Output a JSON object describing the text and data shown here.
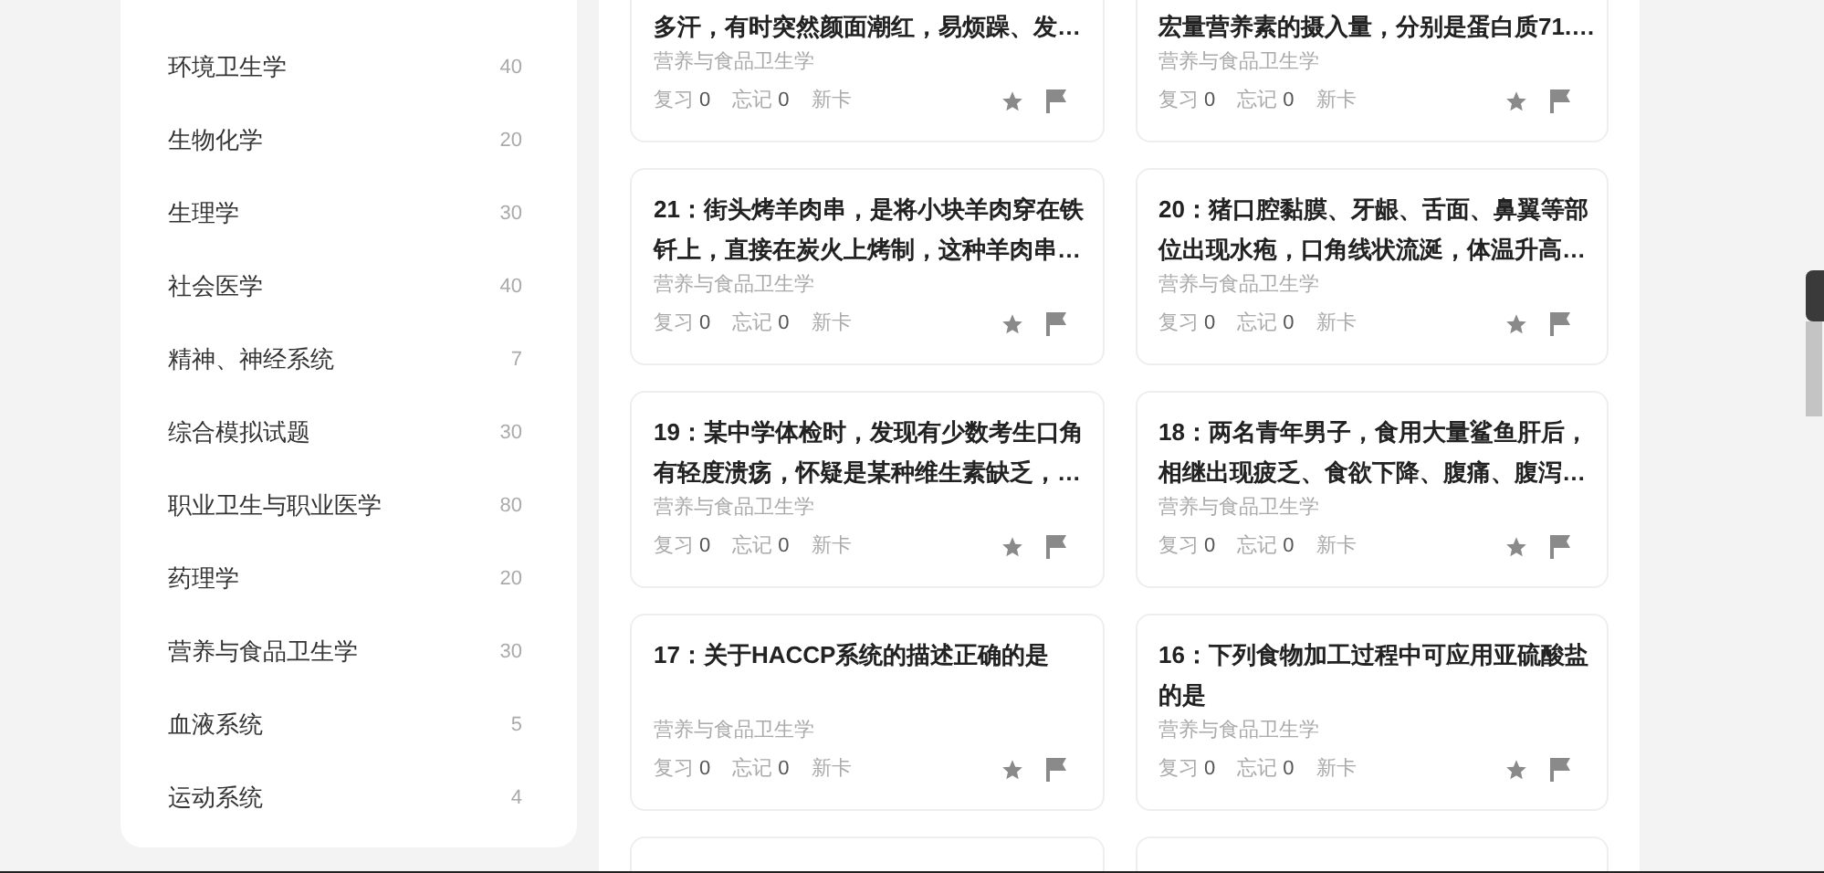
{
  "sidebar": {
    "items": [
      {
        "label": "环境卫生学",
        "count": "40"
      },
      {
        "label": "生物化学",
        "count": "20"
      },
      {
        "label": "生理学",
        "count": "30"
      },
      {
        "label": "社会医学",
        "count": "40"
      },
      {
        "label": "精神、神经系统",
        "count": "7"
      },
      {
        "label": "综合模拟试题",
        "count": "30"
      },
      {
        "label": "职业卫生与职业医学",
        "count": "80"
      },
      {
        "label": "药理学",
        "count": "20"
      },
      {
        "label": "营养与食品卫生学",
        "count": "30"
      },
      {
        "label": "血液系统",
        "count": "5"
      },
      {
        "label": "运动系统",
        "count": "4"
      }
    ]
  },
  "cards": [
    {
      "title": "多汗，有时突然颜面潮红，易烦躁、发…",
      "cut_top": true,
      "category": "营养与食品卫生学",
      "review": {
        "label": "复习",
        "count": "0"
      },
      "forgot": {
        "label": "忘记",
        "count": "0"
      },
      "status": "新卡"
    },
    {
      "title": "宏量营养素的摄入量，分别是蛋白质71.…",
      "cut_top": true,
      "category": "营养与食品卫生学",
      "review": {
        "label": "复习",
        "count": "0"
      },
      "forgot": {
        "label": "忘记",
        "count": "0"
      },
      "status": "新卡"
    },
    {
      "title": "21：街头烤羊肉串，是将小块羊肉穿在铁钎上，直接在炭火上烤制，这种羊肉串…",
      "cut_top": false,
      "category": "营养与食品卫生学",
      "review": {
        "label": "复习",
        "count": "0"
      },
      "forgot": {
        "label": "忘记",
        "count": "0"
      },
      "status": "新卡"
    },
    {
      "title": "20：猪口腔黏膜、牙龈、舌面、鼻翼等部位出现水疱，口角线状流涎，体温升高…",
      "cut_top": false,
      "category": "营养与食品卫生学",
      "review": {
        "label": "复习",
        "count": "0"
      },
      "forgot": {
        "label": "忘记",
        "count": "0"
      },
      "status": "新卡"
    },
    {
      "title": "19：某中学体检时，发现有少数考生口角有轻度溃疡，怀疑是某种维生素缺乏，…",
      "cut_top": false,
      "category": "营养与食品卫生学",
      "review": {
        "label": "复习",
        "count": "0"
      },
      "forgot": {
        "label": "忘记",
        "count": "0"
      },
      "status": "新卡"
    },
    {
      "title": "18：两名青年男子，食用大量鲨鱼肝后，相继出现疲乏、食欲下降、腹痛、腹泻…",
      "cut_top": false,
      "category": "营养与食品卫生学",
      "review": {
        "label": "复习",
        "count": "0"
      },
      "forgot": {
        "label": "忘记",
        "count": "0"
      },
      "status": "新卡"
    },
    {
      "title": "17：关于HACCP系统的描述正确的是",
      "cut_top": false,
      "category": "营养与食品卫生学",
      "review": {
        "label": "复习",
        "count": "0"
      },
      "forgot": {
        "label": "忘记",
        "count": "0"
      },
      "status": "新卡"
    },
    {
      "title": "16：下列食物加工过程中可应用亚硫酸盐的是",
      "cut_top": false,
      "category": "营养与食品卫生学",
      "review": {
        "label": "复习",
        "count": "0"
      },
      "forgot": {
        "label": "忘记",
        "count": "0"
      },
      "status": "新卡"
    }
  ]
}
